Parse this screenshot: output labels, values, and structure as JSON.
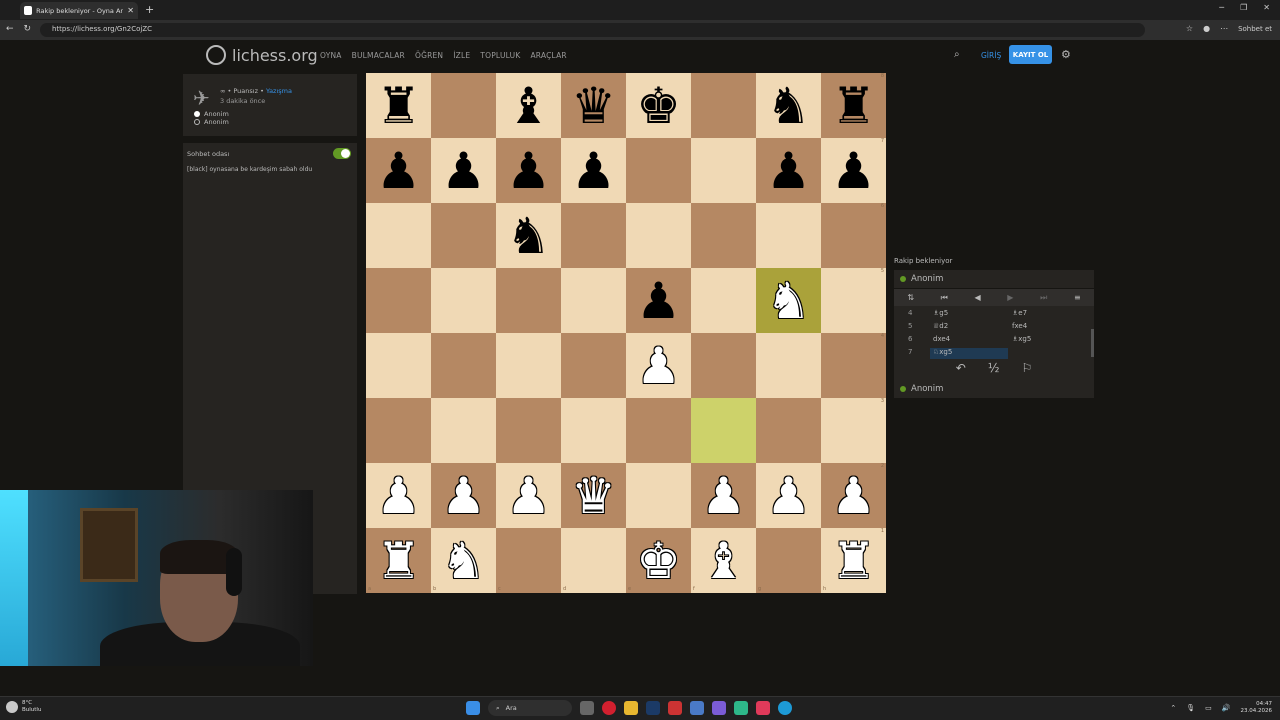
{
  "browser": {
    "tab_title": "Rakip bekleniyor - Oyna Anon",
    "url": "https://lichess.org/Gn2CojZC",
    "sohbet_label": "Sohbet et"
  },
  "header": {
    "logo_text": "lichess.org",
    "menu": [
      "OYNA",
      "BULMACALAR",
      "ÖĞREN",
      "İZLE",
      "TOPLULUK",
      "ARAÇLAR"
    ],
    "login": "GİRİŞ",
    "signup": "KAYIT OL"
  },
  "game_info": {
    "mode": "∞ • Puansız •",
    "variant_link": "Yazışma",
    "ago": "3 dakika önce",
    "white_player": "Anonim",
    "black_player": "Anonim"
  },
  "chat": {
    "title": "Sohbet odası",
    "message": "[black] oynasana be kardeşim sabah oldu"
  },
  "board": {
    "highlight_squares": [
      "g5",
      "f3"
    ],
    "rank_labels": [
      "8",
      "7",
      "6",
      "5",
      "4",
      "3",
      "2",
      "1"
    ],
    "file_labels": [
      "a",
      "b",
      "c",
      "d",
      "e",
      "f",
      "g",
      "h"
    ],
    "pieces_by_rank": [
      [
        "♜",
        "",
        "♝",
        "♛",
        "♚",
        "",
        "♞",
        "♜"
      ],
      [
        "♟",
        "♟",
        "♟",
        "♟",
        "",
        "",
        "♟",
        "♟"
      ],
      [
        "",
        "",
        "♞",
        "",
        "",
        "",
        "",
        ""
      ],
      [
        "",
        "",
        "",
        "",
        "♟",
        "",
        "♞",
        ""
      ],
      [
        "",
        "",
        "",
        "",
        "♟",
        "",
        "",
        ""
      ],
      [
        "",
        "",
        "",
        "",
        "",
        "",
        "",
        ""
      ],
      [
        "♟",
        "♟",
        "♟",
        "♛",
        "",
        "♟",
        "♟",
        "♟"
      ],
      [
        "♜",
        "♞",
        "",
        "",
        "♚",
        "♝",
        "",
        "♜"
      ]
    ],
    "colors_by_rank": [
      [
        "b",
        "",
        "b",
        "b",
        "b",
        "",
        "b",
        "b"
      ],
      [
        "b",
        "b",
        "b",
        "b",
        "",
        "",
        "b",
        "b"
      ],
      [
        "",
        "",
        "b",
        "",
        "",
        "",
        "",
        ""
      ],
      [
        "",
        "",
        "",
        "",
        "b",
        "",
        "w",
        ""
      ],
      [
        "",
        "",
        "",
        "",
        "w",
        "",
        "",
        ""
      ],
      [
        "",
        "",
        "",
        "",
        "",
        "",
        "",
        ""
      ],
      [
        "w",
        "w",
        "w",
        "w",
        "",
        "w",
        "w",
        "w"
      ],
      [
        "w",
        "w",
        "",
        "",
        "w",
        "w",
        "",
        "w"
      ]
    ]
  },
  "side_panel": {
    "status": "Rakip bekleniyor",
    "top_player": "Anonim",
    "bottom_player": "Anonim",
    "moves": [
      {
        "n": "4",
        "w": "♗g5",
        "b": "♗e7"
      },
      {
        "n": "5",
        "w": "♕d2",
        "b": "fxe4"
      },
      {
        "n": "6",
        "w": "dxe4",
        "b": "♗xg5"
      },
      {
        "n": "7",
        "w": "♘xg5",
        "b": ""
      }
    ],
    "draw_label": "½"
  },
  "taskbar": {
    "weather_temp": "8°C",
    "weather_desc": "Bulutlu",
    "search_label": "Ara",
    "time": "04:47",
    "date": "23.04.2026"
  },
  "colors": {
    "light_square": "#f0d9b5",
    "dark_square": "#b58863",
    "accent": "#3692e7",
    "online": "#629924"
  }
}
